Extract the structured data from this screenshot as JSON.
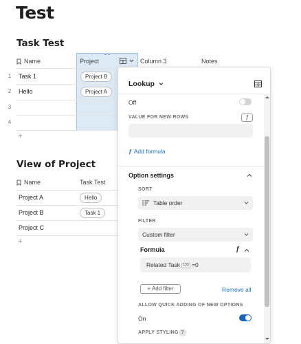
{
  "page": {
    "title": "Test"
  },
  "table1": {
    "title": "Task Test",
    "headers": {
      "name": "Name",
      "project": "Project",
      "column3": "Column 3",
      "notes": "Notes"
    },
    "rows": [
      {
        "num": "1",
        "name": "Task 1",
        "project": "Project B"
      },
      {
        "num": "2",
        "name": "Hello",
        "project": "Project A"
      },
      {
        "num": "3",
        "name": "",
        "project": ""
      },
      {
        "num": "4",
        "name": "",
        "project": ""
      }
    ],
    "add_row": "+"
  },
  "table2": {
    "title": "View of Project",
    "headers": {
      "name": "Name",
      "task_test": "Task Test"
    },
    "rows": [
      {
        "name": "Project A",
        "task": "Hello"
      },
      {
        "name": "Project B",
        "task": "Task 1"
      },
      {
        "name": "Project C",
        "task": ""
      }
    ],
    "add_row": "+"
  },
  "panel": {
    "column_type": "Lookup",
    "off_label": "Off",
    "value_for_new_rows_label": "VALUE FOR NEW ROWS",
    "add_formula": "Add formula",
    "option_settings": "Option settings",
    "sort_label": "SORT",
    "sort_value": "Table order",
    "filter_label": "FILTER",
    "filter_value": "Custom filter",
    "formula_label": "Formula",
    "formula_text": "Related Task",
    "formula_badge": "123",
    "formula_suffix": "=0",
    "add_filter": "Add filter",
    "remove_all": "Remove all",
    "allow_quick_label": "ALLOW QUICK ADDING OF NEW OPTIONS",
    "on_label": "On",
    "apply_styling_label": "APPLY STYLING",
    "help": "?"
  },
  "colors": {
    "accent": "#1c6fc4",
    "toggle_on": "#1a63b5",
    "toggle_off": "#d4d4d4",
    "selection": "#dceaf5"
  }
}
